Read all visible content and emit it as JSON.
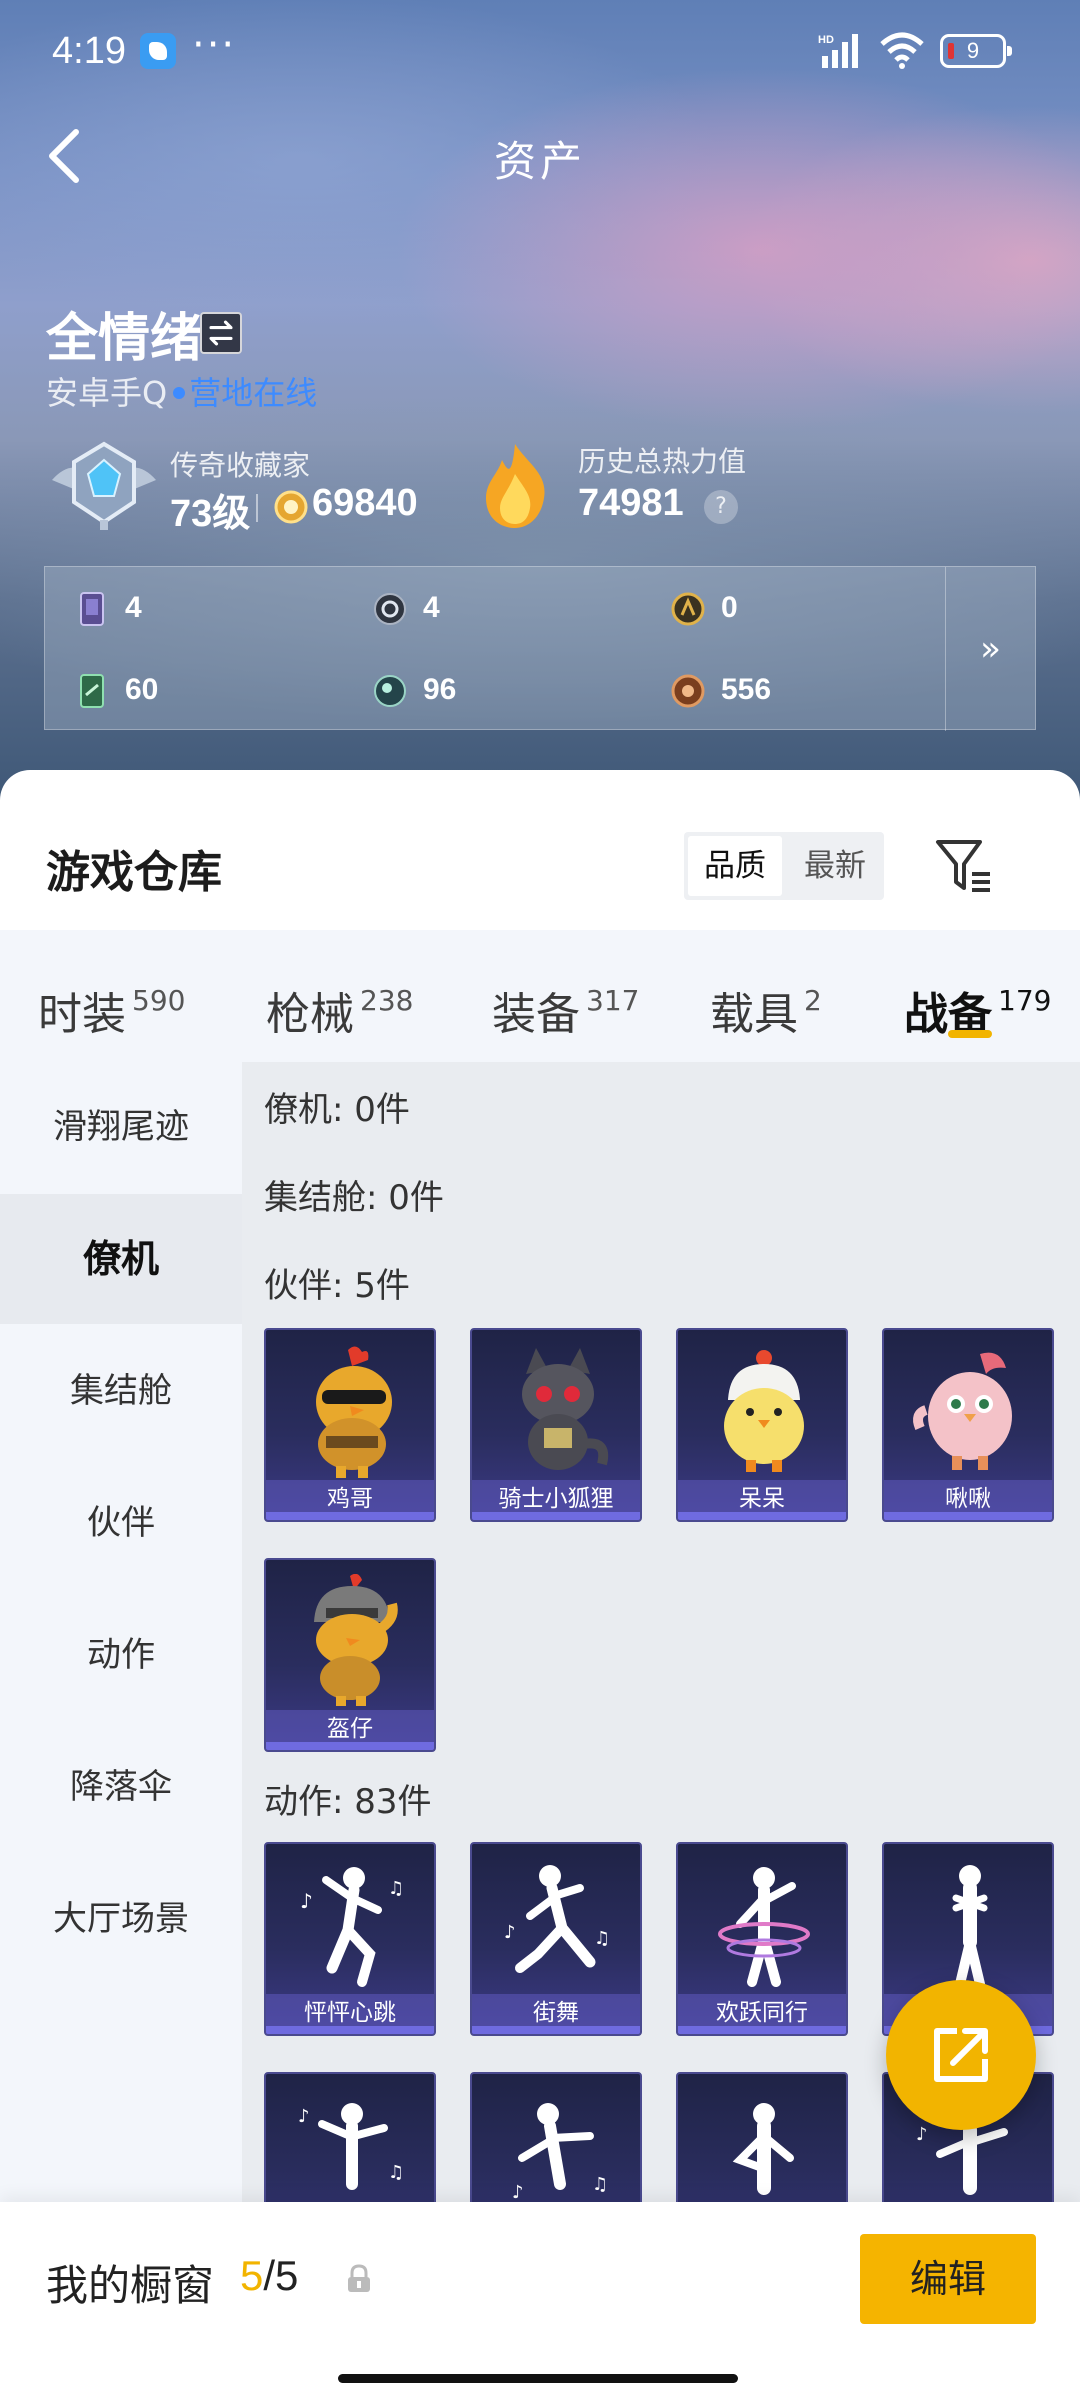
{
  "status_bar": {
    "time": "4:19",
    "dots": "···",
    "battery": "9"
  },
  "header": {
    "title": "资产"
  },
  "profile": {
    "name": "全情绪",
    "platform": "安卓手Q",
    "online_text": "营地在线",
    "collector_title": "传奇收藏家",
    "level": "73级",
    "coins": "69840",
    "heat_title": "历史总热力值",
    "heat_value": "74981",
    "help": "?"
  },
  "stats": {
    "row1": [
      "4",
      "4",
      "0"
    ],
    "row2": [
      "60",
      "96",
      "556"
    ],
    "more": "»"
  },
  "warehouse": {
    "title": "游戏仓库",
    "sort_options": [
      "品质",
      "最新"
    ]
  },
  "tabs": [
    {
      "label": "时装",
      "count": "590"
    },
    {
      "label": "枪械",
      "count": "238"
    },
    {
      "label": "装备",
      "count": "317"
    },
    {
      "label": "载具",
      "count": "2"
    },
    {
      "label": "战备",
      "count": "179"
    }
  ],
  "sidebar": [
    "滑翔尾迹",
    "僚机",
    "集结舱",
    "伙伴",
    "动作",
    "降落伞",
    "大厅场景"
  ],
  "sections": {
    "wingman": "僚机: 0件",
    "pod": "集结舱: 0件",
    "partner": "伙伴: 5件",
    "action": "动作: 83件"
  },
  "partners": [
    "鸡哥",
    "骑士小狐狸",
    "呆呆",
    "啾啾",
    "盔仔"
  ],
  "actions": [
    "怦怦心跳",
    "街舞",
    "欢跃同行"
  ],
  "showcase": {
    "label": "我的橱窗",
    "current": "5",
    "total": "/5",
    "edit": "编辑"
  },
  "colors": {
    "accent": "#f2b400",
    "online": "#3d8bff"
  }
}
